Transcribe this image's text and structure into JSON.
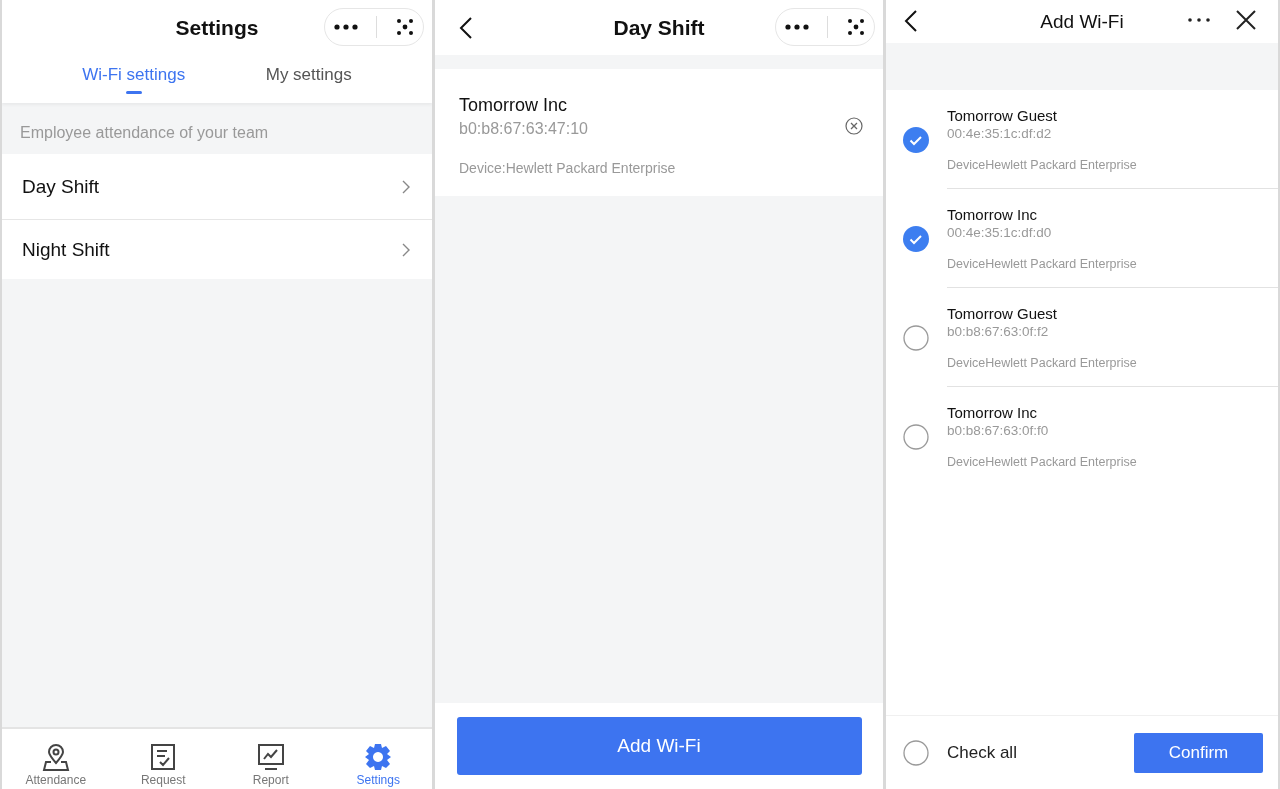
{
  "settings_screen": {
    "title": "Settings",
    "tabs": [
      {
        "label": "Wi-Fi settings",
        "selected": true
      },
      {
        "label": "My settings",
        "selected": false
      }
    ],
    "section_header": "Employee attendance of your team",
    "shifts": [
      {
        "label": "Day Shift"
      },
      {
        "label": "Night Shift"
      }
    ],
    "bottom_nav": [
      {
        "label": "Attendance",
        "kind": "pin",
        "selected": false
      },
      {
        "label": "Request",
        "kind": "form",
        "selected": false
      },
      {
        "label": "Report",
        "kind": "chart",
        "selected": false
      },
      {
        "label": "Settings",
        "kind": "gear",
        "selected": true
      }
    ]
  },
  "day_shift_screen": {
    "title": "Day Shift",
    "wifi": {
      "name": "Tomorrow Inc",
      "mac": "b0:b8:67:63:47:10",
      "device": "Device:Hewlett Packard Enterprise"
    },
    "add_button": "Add Wi-Fi"
  },
  "add_wifi_screen": {
    "title": "Add Wi-Fi",
    "networks": [
      {
        "name": "Tomorrow Guest",
        "mac": "00:4e:35:1c:df:d2",
        "device": "DeviceHewlett Packard Enterprise",
        "checked": true
      },
      {
        "name": "Tomorrow Inc",
        "mac": "00:4e:35:1c:df:d0",
        "device": "DeviceHewlett Packard Enterprise",
        "checked": true
      },
      {
        "name": "Tomorrow Guest",
        "mac": "b0:b8:67:63:0f:f2",
        "device": "DeviceHewlett Packard Enterprise",
        "checked": false
      },
      {
        "name": "Tomorrow Inc",
        "mac": "b0:b8:67:63:0f:f0",
        "device": "DeviceHewlett Packard Enterprise",
        "checked": false
      }
    ],
    "check_all": {
      "label": "Check all",
      "checked": false
    },
    "confirm_button": "Confirm"
  }
}
